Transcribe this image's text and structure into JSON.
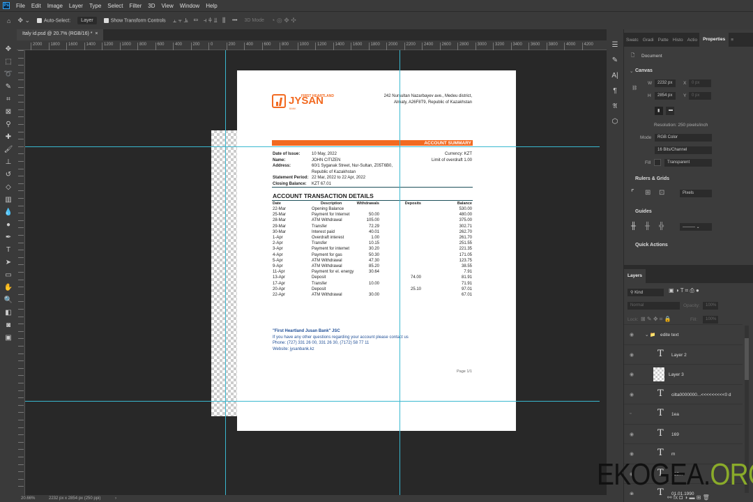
{
  "app": {
    "logo": "Ps",
    "menu": [
      "File",
      "Edit",
      "Image",
      "Layer",
      "Type",
      "Select",
      "Filter",
      "3D",
      "View",
      "Window",
      "Help"
    ]
  },
  "options": {
    "auto_select": "Auto-Select:",
    "auto_select_target": "Layer",
    "show_transform": "Show Transform Controls",
    "three_d_mode": "3D Mode",
    "more": "•••"
  },
  "tab": {
    "title": "Italy id.psd @ 20.7% (RGB/16) *",
    "close": "×"
  },
  "ruler": {
    "labels": [
      "2000",
      "1800",
      "1600",
      "1400",
      "1200",
      "1000",
      "800",
      "600",
      "400",
      "200",
      "0",
      "200",
      "400",
      "600",
      "800",
      "1000",
      "1200",
      "1400",
      "1600",
      "1800",
      "2000",
      "2200",
      "2400",
      "2600",
      "2800",
      "3000",
      "3200",
      "3400",
      "3600",
      "3800",
      "4000",
      "4200"
    ]
  },
  "status": {
    "zoom": "20.66%",
    "doc_info": "2232 px x 2854 px (250 ppi)",
    "arrow": "›"
  },
  "document": {
    "logo_text": "JYSAN",
    "logo_sub": "FIRST HEARTLAND",
    "logo_bank": "BANK",
    "address": [
      "242 Nursultan Nazarbayev ave., Medeu district,",
      "Almaty, A26F8T9, Republic of Kazakhstan"
    ],
    "summary_title": "ACCOUNT SUMMARY",
    "info": [
      {
        "label": "Date of Issue:",
        "value": "10 May, 2022"
      },
      {
        "label": "Name:",
        "value": "JOHN CITIZEN"
      },
      {
        "label": "Address:",
        "value": "60/1 Syganak Street, Nur-Sultan, Z05T6B0,"
      },
      {
        "label": "",
        "value": "Republic of Kazakhstan"
      },
      {
        "label": "Statement Period:",
        "value": "22 Mar, 2022 to 22 Apr, 2022"
      },
      {
        "label": "Closing Balance:",
        "value": "KZT 67.01"
      }
    ],
    "currency": "Currency: KZT",
    "overdraft": "Limit of overdraft 1.00",
    "details_title": "ACCOUNT TRANSACTION DETAILS",
    "columns": [
      "Date",
      "Description",
      "Withdrawals",
      "Deposits",
      "Balance"
    ],
    "rows": [
      [
        "22-Mar",
        "Opening Balance",
        "",
        "",
        "530.00"
      ],
      [
        "25-Mar",
        "Payment for Internet",
        "50.00",
        "",
        "480.00"
      ],
      [
        "28-Mar",
        "ATM Withdrawal",
        "105.00",
        "",
        "375.00"
      ],
      [
        "29-Mar",
        "Transfer",
        "72.29",
        "",
        "302.71"
      ],
      [
        "30-Mar",
        "Interest paid",
        "40.01",
        "",
        "262.70"
      ],
      [
        "1-Apr",
        "Overdraft interest",
        "1.00",
        "",
        "261.70"
      ],
      [
        "2-Apr",
        "Transfer",
        "10.15",
        "",
        "251.55"
      ],
      [
        "3-Apr",
        "Payment for internet",
        "30.20",
        "",
        "221.35"
      ],
      [
        "4-Apr",
        "Payment for gas",
        "50.30",
        "",
        "171.05"
      ],
      [
        "5-Apr",
        "ATM Withdrawal",
        "47.30",
        "",
        "123.75"
      ],
      [
        "9-Apr",
        "ATM Withdrawal",
        "85.20",
        "",
        "38.55"
      ],
      [
        "11-Apr",
        "Payment for el. energy",
        "30.64",
        "",
        "7.91"
      ],
      [
        "13-Apr",
        "Deposit",
        "",
        "74.00",
        "81.91"
      ],
      [
        "17-Apr",
        "Transfer",
        "10.00",
        "",
        "71.91"
      ],
      [
        "20-Apr",
        "Deposit",
        "",
        "25.10",
        "97.01"
      ],
      [
        "22-Apr",
        "ATM Withdrawal",
        "30.00",
        "",
        "67.01"
      ]
    ],
    "footer": [
      "\"First Heartland Jusan Bank\" JSC",
      "If you have any other questions regarding your account please contact us",
      "Phone: (727) 331 26 00, 331 26 30, (7172) 58 77 11",
      "Website: jysanbank.kz"
    ],
    "page": "Page 1/1",
    "brand_color": "#f26a21",
    "footer_color": "#1f4e96"
  },
  "properties": {
    "tabs": [
      "Swatc",
      "Gradi",
      "Patte",
      "Histo",
      "Actio",
      "Properties"
    ],
    "doc_label": "Document",
    "canvas_title": "Canvas",
    "w_label": "W",
    "w": "2232 px",
    "h_label": "H",
    "h": "2854 px",
    "x_label": "X",
    "x": "0 px",
    "y_label": "Y",
    "y": "0 px",
    "resolution": "Resolution: 250 pixels/inch",
    "mode_label": "Mode",
    "mode": "RGB Color",
    "depth": "16 Bits/Channel",
    "fill_label": "Fill",
    "fill": "Transparent",
    "rulers_title": "Rulers & Grids",
    "units": "Pixels",
    "guides_title": "Guides",
    "quick_actions": "Quick Actions"
  },
  "layers": {
    "title": "Layers",
    "kind": "Kind",
    "blend": "Normal",
    "opacity_label": "Opacity:",
    "opacity": "100%",
    "lock_label": "Lock:",
    "fill_label": "Fill:",
    "fill": "100%",
    "items": [
      {
        "name": "edite text",
        "type": "group",
        "visible": true
      },
      {
        "name": "Layer 2",
        "type": "text",
        "visible": true
      },
      {
        "name": "Layer 3",
        "type": "image",
        "visible": true
      },
      {
        "name": "cilta0000000...<<<<<<<<<0 d",
        "type": "text",
        "visible": true
      },
      {
        "name": "1ea",
        "type": "text",
        "visible": false
      },
      {
        "name": "169",
        "type": "text",
        "visible": true
      },
      {
        "name": "m",
        "type": "text",
        "visible": true
      },
      {
        "name": "125...",
        "type": "text",
        "visible": true
      },
      {
        "name": "01.01.1990",
        "type": "text",
        "visible": true
      }
    ]
  },
  "watermark": {
    "part1": "EKOGEA.",
    "part2": "ORG",
    "color2": "#8aab2a"
  }
}
